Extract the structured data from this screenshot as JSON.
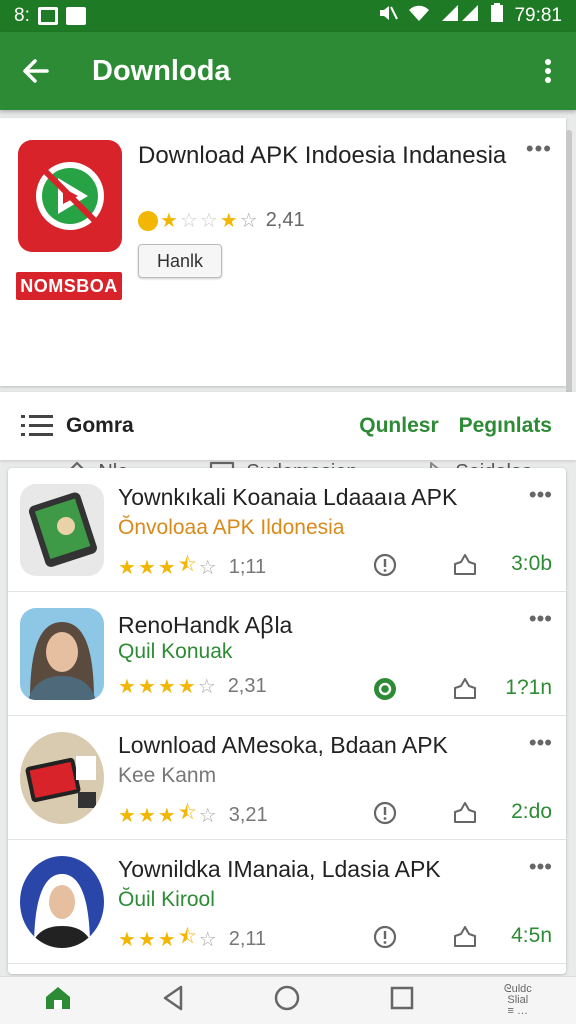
{
  "status_bar": {
    "time_left": "8:",
    "time_right": "79:81"
  },
  "app_bar": {
    "title": "Downloda"
  },
  "app": {
    "title": "Download APK Indoesia Indanesia",
    "rating": "2,41",
    "brand_tag": "NOMSBOA",
    "action_label": "Hanlk"
  },
  "tabs": [
    {
      "label": "Nle",
      "icon": "tag-icon"
    },
    {
      "label": "Sudomesion",
      "icon": "comment-icon",
      "active": true
    },
    {
      "label": "Soidalas",
      "icon": "share-icon"
    }
  ],
  "filter": {
    "label": "Gomra",
    "link1": "Qunlesr",
    "link2": "Pegınlats"
  },
  "items": [
    {
      "name": "Yownkıkali Koanaia Ldaaaıa APK",
      "subtitle": "Ŏnvoloaa APK Ildonesia",
      "subtitle_style": "orange",
      "rating": "1;11",
      "stars": 3.5,
      "size": "3:0b",
      "info_icon": "info-icon"
    },
    {
      "name": "RenoHandk Aꞵla",
      "subtitle": "Quil Konuak",
      "subtitle_style": "orange",
      "rating": "2,31",
      "stars": 4,
      "size": "1?1n",
      "info_icon": "verified-icon"
    },
    {
      "name": "Lownload AMesoka, Bdaan APK",
      "subtitle": "Kee Kanm",
      "subtitle_style": "gray",
      "rating": "3,21",
      "stars": 3.5,
      "size": "2:do",
      "info_icon": "info-icon"
    },
    {
      "name": "Yownildka IManaia, Ldasia APK",
      "subtitle": "Ŏuil Kirool",
      "subtitle_style": "orange",
      "rating": "2,11",
      "stars": 3.5,
      "size": "4:5n",
      "info_icon": "info-icon"
    }
  ],
  "nav": {
    "corner_text": "ᘓuldc\nSlial\n≡ …"
  },
  "colors": {
    "primary": "#2e8b35",
    "status": "#1e7a24",
    "brand_red": "#d8232a",
    "star": "#f2b705"
  }
}
